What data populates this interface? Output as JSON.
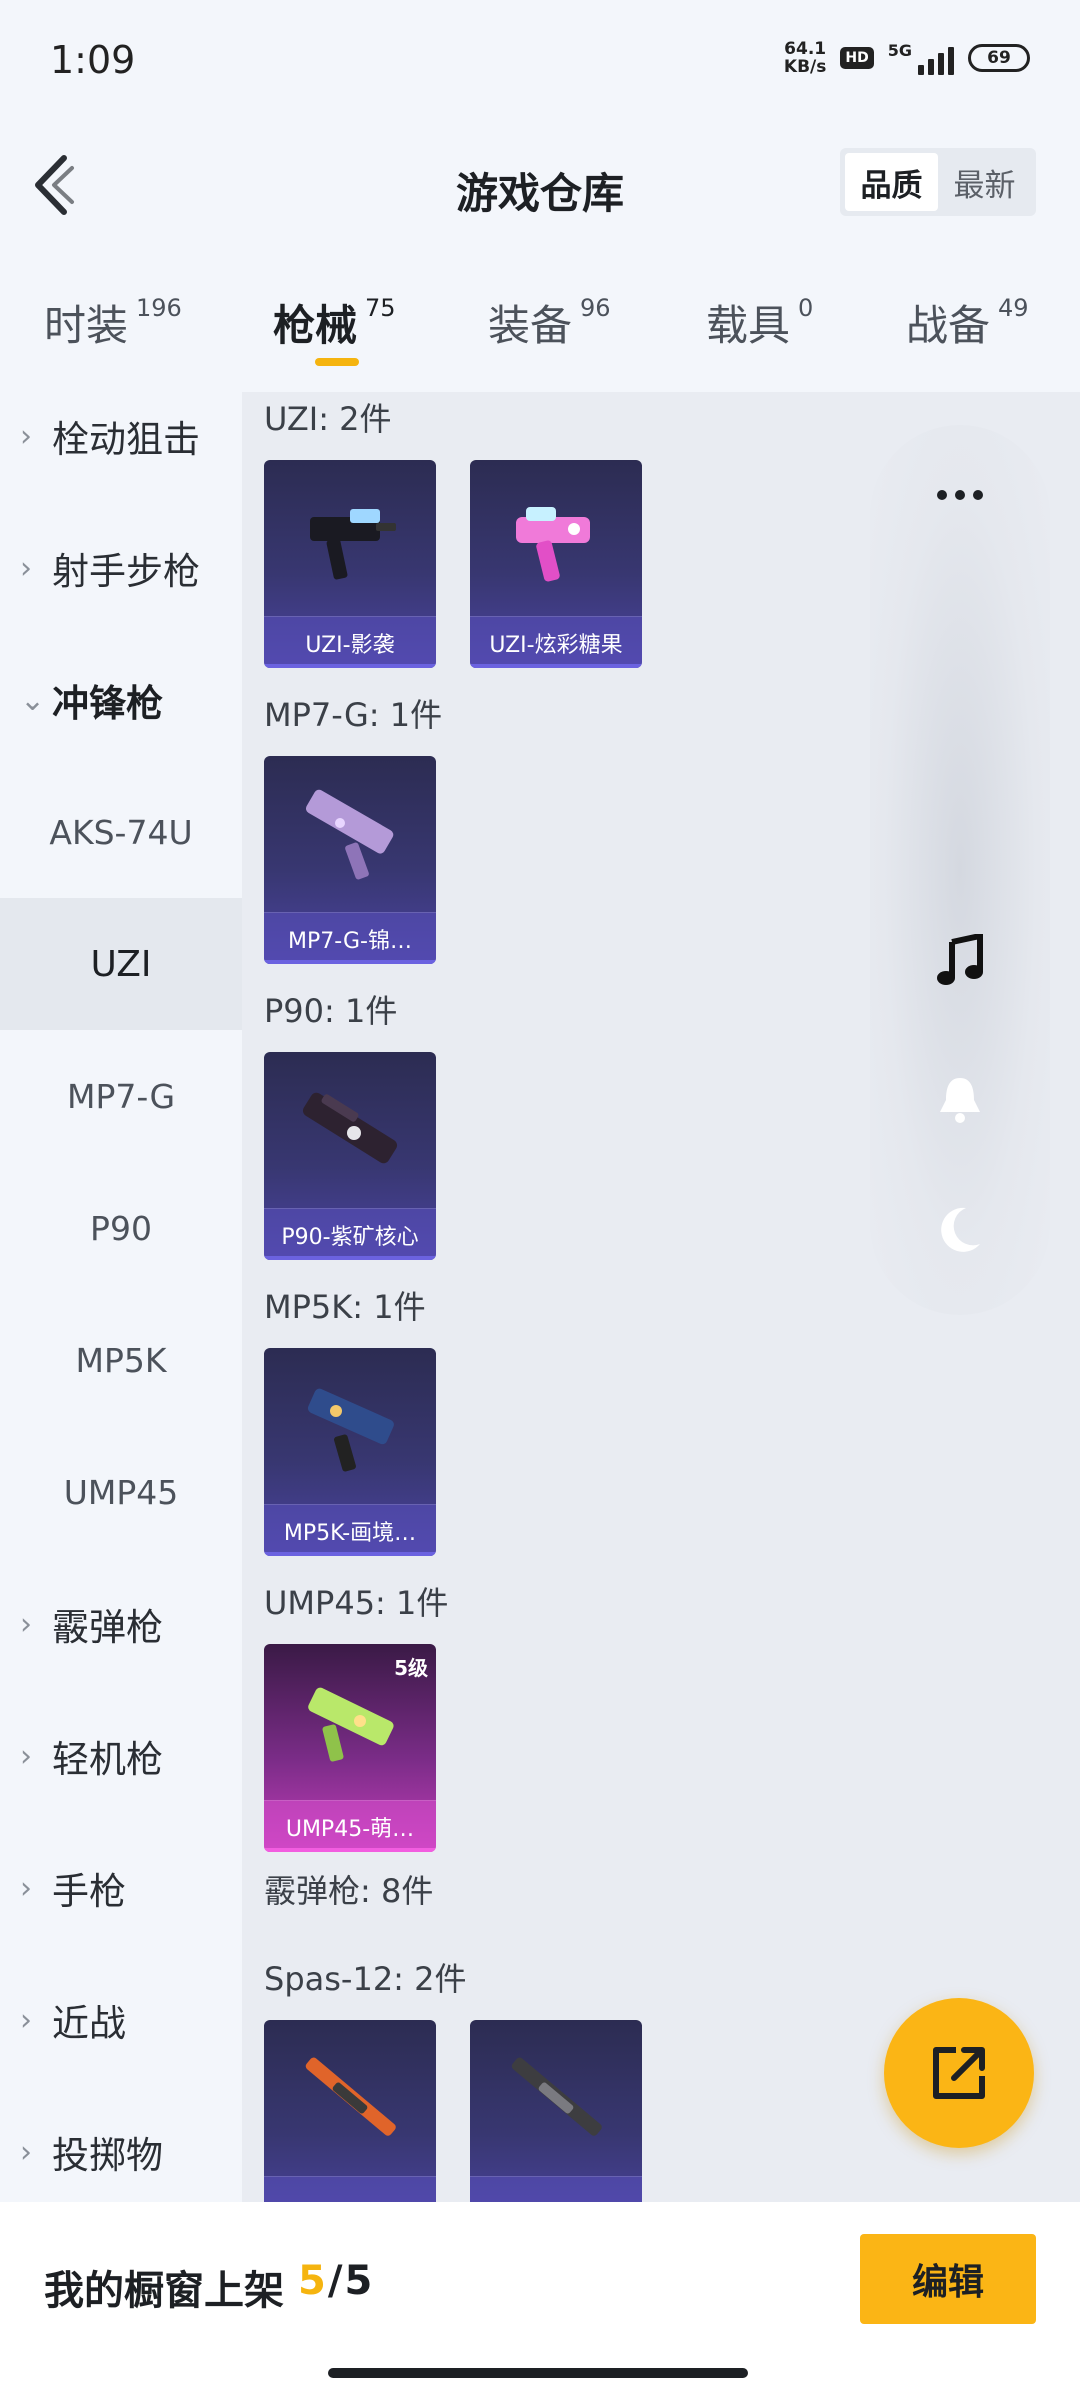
{
  "status_bar": {
    "time": "1:09",
    "net_speed_value": "64.1",
    "net_speed_unit": "KB/s",
    "hd": "HD",
    "network": "5G",
    "battery": "69"
  },
  "header": {
    "title": "游戏仓库",
    "sort_options": [
      {
        "label": "品质",
        "active": true
      },
      {
        "label": "最新",
        "active": false
      }
    ]
  },
  "tabs": [
    {
      "label": "时装",
      "count": "196"
    },
    {
      "label": "枪械",
      "count": "75",
      "active": true
    },
    {
      "label": "装备",
      "count": "96"
    },
    {
      "label": "载具",
      "count": "0"
    },
    {
      "label": "战备",
      "count": "49"
    }
  ],
  "sidebar": {
    "items": [
      {
        "type": "group",
        "label": "栓动狙击"
      },
      {
        "type": "group",
        "label": "射手步枪"
      },
      {
        "type": "group",
        "label": "冲锋枪",
        "open": true
      },
      {
        "type": "sub",
        "label": "AKS-74U"
      },
      {
        "type": "sub",
        "label": "UZI",
        "active": true
      },
      {
        "type": "sub",
        "label": "MP7-G"
      },
      {
        "type": "sub",
        "label": "P90"
      },
      {
        "type": "sub",
        "label": "MP5K"
      },
      {
        "type": "sub",
        "label": "UMP45"
      },
      {
        "type": "group",
        "label": "霰弹枪"
      },
      {
        "type": "group",
        "label": "轻机枪"
      },
      {
        "type": "group",
        "label": "手枪"
      },
      {
        "type": "group",
        "label": "近战"
      },
      {
        "type": "group",
        "label": "投掷物"
      }
    ]
  },
  "main": {
    "sections": [
      {
        "title": "UZI: 2件",
        "items": [
          {
            "label": "UZI-影袭"
          },
          {
            "label": "UZI-炫彩糖果"
          }
        ]
      },
      {
        "title": "MP7-G: 1件",
        "items": [
          {
            "label": "MP7-G-锦…"
          }
        ]
      },
      {
        "title": "P90: 1件",
        "items": [
          {
            "label": "P90-紫矿核心"
          }
        ]
      },
      {
        "title": "MP5K: 1件",
        "items": [
          {
            "label": "MP5K-画境…"
          }
        ]
      },
      {
        "title": "UMP45: 1件",
        "items": [
          {
            "label": "UMP45-萌…",
            "level": "5级",
            "rarity": "pink"
          }
        ]
      },
      {
        "title": "霰弹枪: 8件",
        "items": []
      },
      {
        "title": "Spas-12: 2件",
        "items": [
          {
            "label": ""
          },
          {
            "label": ""
          }
        ]
      }
    ]
  },
  "float_panel": {
    "icons": [
      "more-icon",
      "music-icon",
      "bell-icon",
      "moon-icon"
    ]
  },
  "fab": {
    "icon": "share-icon"
  },
  "bottom_bar": {
    "label": "我的橱窗上架",
    "current": "5",
    "slash": "/",
    "total": "5",
    "edit_label": "编辑"
  },
  "colors": {
    "accent": "#fbb515",
    "tab_indicator": "#f5b40f",
    "card_purple": "#383771",
    "card_pink": "#c23db8"
  }
}
